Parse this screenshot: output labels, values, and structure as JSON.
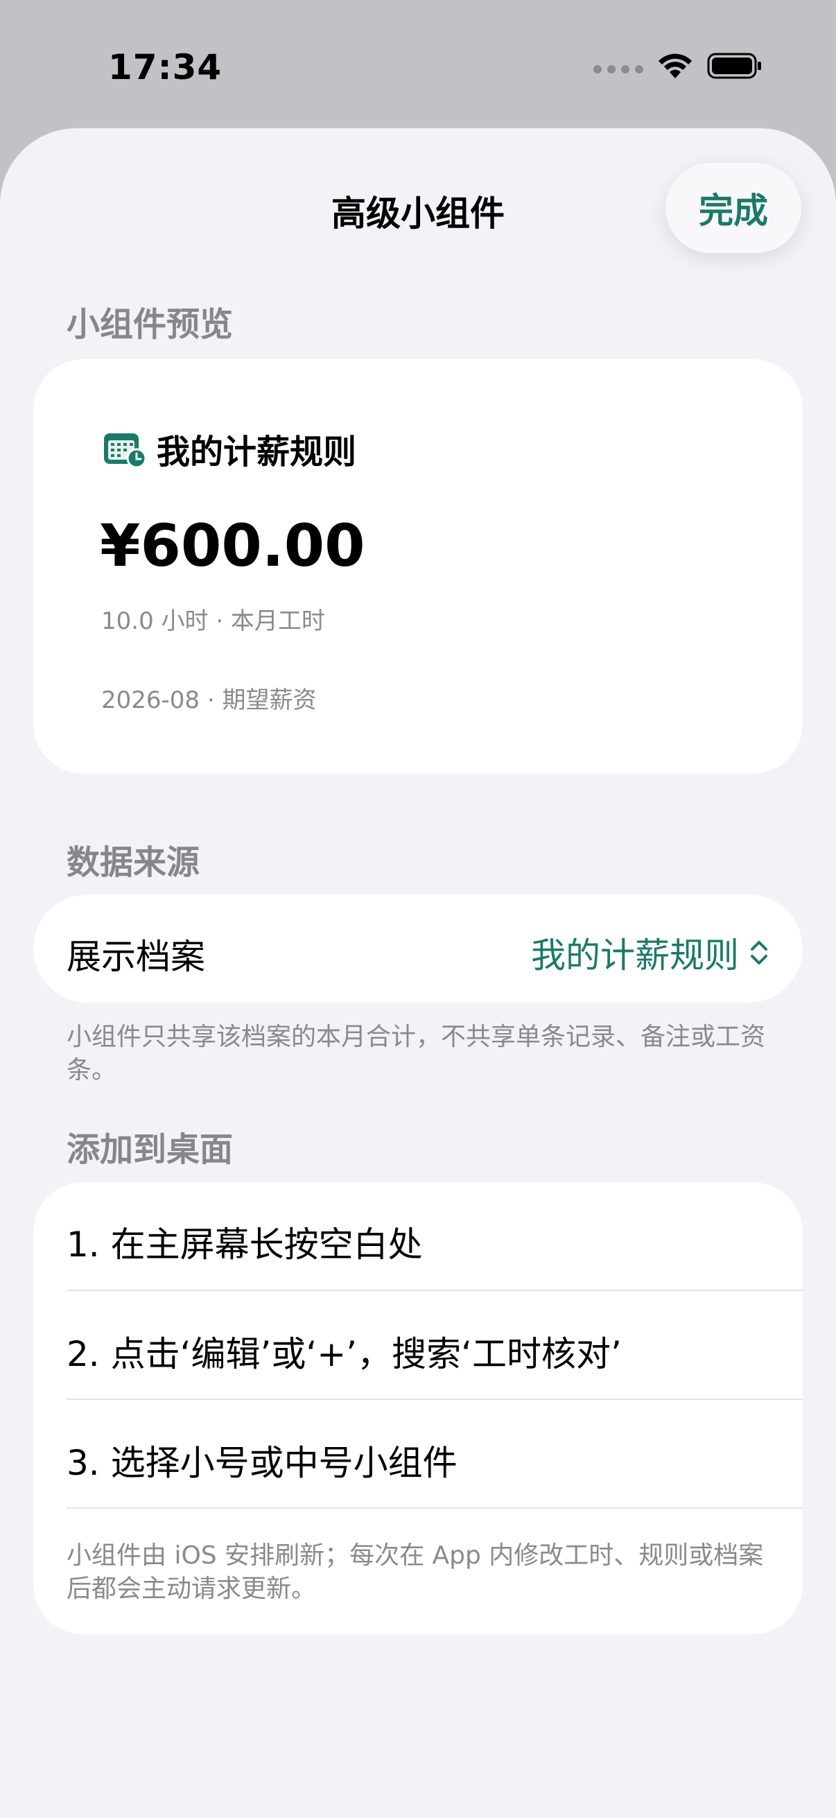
{
  "status": {
    "time": "17:34"
  },
  "nav": {
    "title": "高级小组件",
    "done_label": "完成"
  },
  "preview": {
    "header": "小组件预览",
    "widget_title": "我的计薪规则",
    "amount": "¥600.00",
    "hours_line": "10.0 小时 · 本月工时",
    "period_line": "2026-08 · 期望薪资"
  },
  "source": {
    "header": "数据来源",
    "row_label": "展示档案",
    "row_value": "我的计薪规则",
    "footnote": "小组件只共享该档案的本月合计，不共享单条记录、备注或工资条。"
  },
  "desktop": {
    "header": "添加到桌面",
    "steps": [
      "1. 在主屏幕长按空白处",
      "2. 点击‘编辑’或‘+’，搜索‘工时核对’",
      "3. 选择小号或中号小组件"
    ],
    "footnote": "小组件由 iOS 安排刷新；每次在 App 内修改工时、规则或档案后都会主动请求更新。"
  },
  "colors": {
    "accent": "#1a7a68",
    "background": "#f2f2f7",
    "secondary_text": "#8a8a8e"
  },
  "icons": {
    "widget": "calendar-clock-icon",
    "value_picker": "chevron-up-down-icon"
  }
}
